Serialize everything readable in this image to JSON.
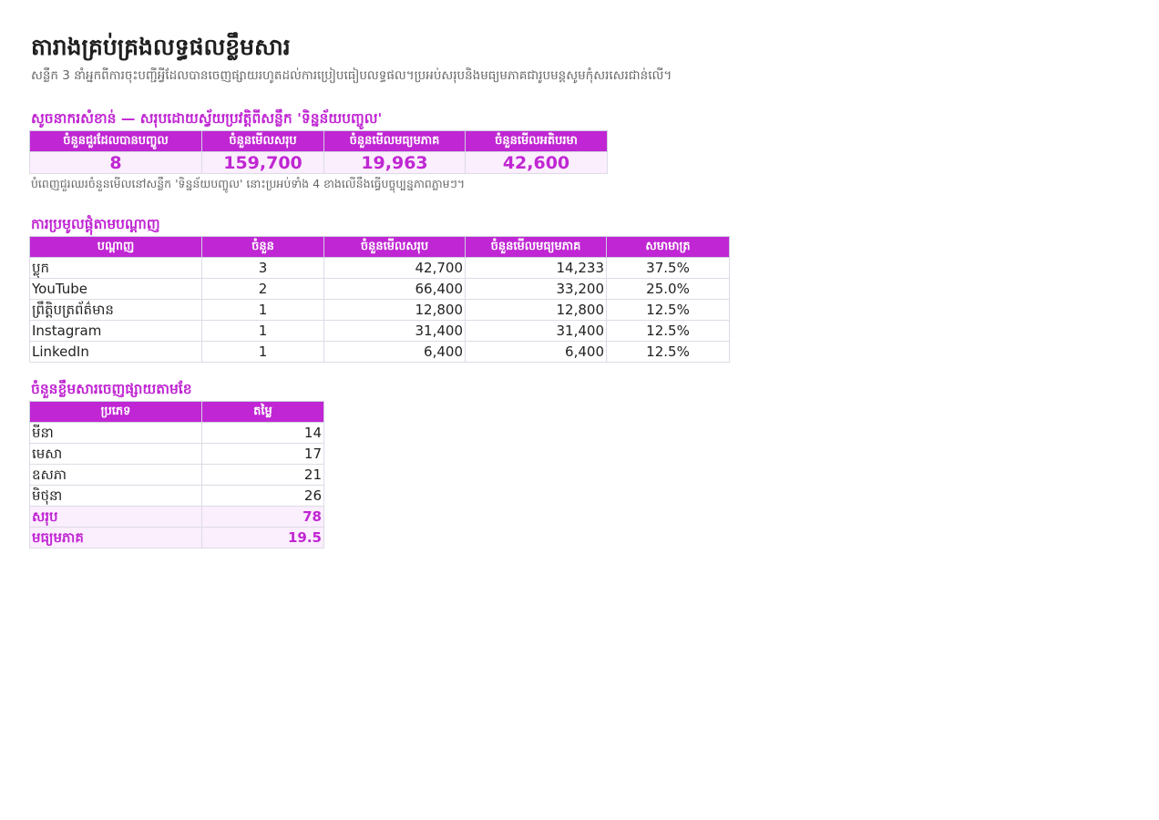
{
  "header": {
    "title": "តារាងគ្រប់គ្រងលទ្ធផលខ្លឹមសារ",
    "subtitle": "សន្លឹក 3 នាំអ្នកពីការចុះបញ្ជីអ្វីដែលបានចេញផ្សាយរហូតដល់ការប្រៀបធៀបលទ្ធផល។ប្រអប់សរុបនិងមធ្យមភាគជារូបមន្តសូមកុំសរសេរជាន់លើ។"
  },
  "kpi": {
    "section_title": "សូចនាករសំខាន់ — សរុបដោយស្វ័យប្រវត្តិពីសន្លឹក 'ទិន្នន័យបញ្ចូល'",
    "headers": [
      "ចំនួនជួរដែលបានបញ្ចូល",
      "ចំនួនមើលសរុប",
      "ចំនួនមើលមធ្យមភាគ",
      "ចំនួនមើលអតិបរមា"
    ],
    "values": [
      "8",
      "159,700",
      "19,963",
      "42,600"
    ],
    "note": "បំពេញជួរឈរចំនួនមើលនៅសន្លឹក 'ទិន្នន័យបញ្ចូល' នោះប្រអប់ទាំង 4 ខាងលើនឹងធ្វើបច្ចុប្បន្នភាពភ្លាមៗ។"
  },
  "channels": {
    "section_title": "ការប្រមូលផ្តុំតាមបណ្តាញ",
    "headers": [
      "បណ្តាញ",
      "ចំនួន",
      "ចំនួនមើលសរុប",
      "ចំនួនមើលមធ្យមភាគ",
      "សមាមាត្រ"
    ],
    "rows": [
      [
        "ប្លុក",
        "3",
        "42,700",
        "14,233",
        "37.5%"
      ],
      [
        "YouTube",
        "2",
        "66,400",
        "33,200",
        "25.0%"
      ],
      [
        "ព្រឹត្តិបត្រព័ត៌មាន",
        "1",
        "12,800",
        "12,800",
        "12.5%"
      ],
      [
        "Instagram",
        "1",
        "31,400",
        "31,400",
        "12.5%"
      ],
      [
        "LinkedIn",
        "1",
        "6,400",
        "6,400",
        "12.5%"
      ]
    ]
  },
  "monthly": {
    "section_title": "ចំនួនខ្លឹមសារចេញផ្សាយតាមខែ",
    "headers": [
      "ប្រភេទ",
      "តម្លៃ"
    ],
    "rows": [
      [
        "មីនា",
        "14"
      ],
      [
        "មេសា",
        "17"
      ],
      [
        "ឧសភា",
        "21"
      ],
      [
        "មិថុនា",
        "26"
      ]
    ],
    "summary": [
      [
        "សរុប",
        "78"
      ],
      [
        "មធ្យមភាគ",
        "19.5"
      ]
    ]
  },
  "colors": {
    "accent": "#c026d3",
    "accent_light": "#fbeefd",
    "text": "#222222",
    "muted": "#666666"
  }
}
